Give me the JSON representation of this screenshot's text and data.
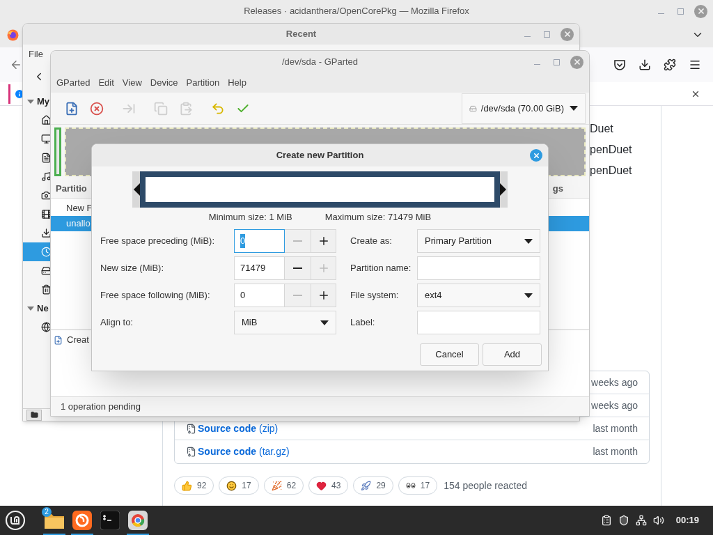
{
  "firefox": {
    "title": "Releases · acidanthera/OpenCorePkg — Mozilla Firefox",
    "page_lines": [
      "Duet",
      "penDuet",
      "penDuet"
    ],
    "assets": [
      {
        "time": "weeks ago"
      },
      {
        "time": "weeks ago"
      },
      {
        "name": "Source code",
        "ext": "(zip)",
        "time": "last month"
      },
      {
        "name": "Source code",
        "ext": "(tar.gz)",
        "time": "last month"
      }
    ],
    "reactions": [
      {
        "kind": "thumbs_up",
        "count": "92"
      },
      {
        "kind": "laugh",
        "count": "17"
      },
      {
        "kind": "hooray",
        "count": "62"
      },
      {
        "kind": "heart",
        "count": "43"
      },
      {
        "kind": "rocket",
        "count": "29"
      },
      {
        "kind": "eyes",
        "count": "17"
      }
    ],
    "reactions_summary": "154 people reacted"
  },
  "files_window": {
    "title": "Recent",
    "menu": [
      "File"
    ],
    "sidebar": [
      {
        "heading": "My",
        "items": [
          {
            "kind": "home",
            "selected": false
          },
          {
            "kind": "desktop",
            "selected": false
          },
          {
            "kind": "documents",
            "selected": false
          },
          {
            "kind": "music",
            "selected": false
          },
          {
            "kind": "pictures",
            "selected": false
          },
          {
            "kind": "videos",
            "selected": false
          },
          {
            "kind": "downloads",
            "selected": false
          },
          {
            "kind": "recent",
            "selected": true
          },
          {
            "kind": "computer",
            "selected": false
          },
          {
            "kind": "trash",
            "selected": false
          }
        ]
      },
      {
        "heading": "Ne",
        "items": [
          {
            "kind": "network",
            "selected": false
          }
        ]
      }
    ]
  },
  "gparted": {
    "title": "/dev/sda - GParted",
    "menu": [
      "GParted",
      "Edit",
      "View",
      "Device",
      "Partition",
      "Help"
    ],
    "toolbar": [
      {
        "kind": "new",
        "disabled": false
      },
      {
        "kind": "delete",
        "disabled": false
      },
      {
        "kind": "resize",
        "disabled": true
      },
      {
        "kind": "copy",
        "disabled": true
      },
      {
        "kind": "paste",
        "disabled": true
      },
      {
        "kind": "undo",
        "disabled": false
      },
      {
        "kind": "apply",
        "disabled": false
      }
    ],
    "device": "/dev/sda (70.00 GiB)",
    "columns": [
      "Partitio",
      "gs"
    ],
    "rows": [
      {
        "cell": "New F",
        "selected": false
      },
      {
        "cell": "unallo",
        "selected": true
      }
    ],
    "operations": [
      "Creat"
    ],
    "status": "1 operation pending"
  },
  "dialog": {
    "title": "Create new Partition",
    "min_size": "Minimum size: 1 MiB",
    "max_size": "Maximum size: 71479 MiB",
    "left_rows": [
      {
        "label": "Free space preceding (MiB):",
        "kind": "spin",
        "value": "0",
        "focused": true,
        "minus_disabled": true,
        "plus_disabled": false
      },
      {
        "label": "New size (MiB):",
        "kind": "spin",
        "value": "71479",
        "focused": false,
        "minus_disabled": false,
        "plus_disabled": true
      },
      {
        "label": "Free space following (MiB):",
        "kind": "spin",
        "value": "0",
        "focused": false,
        "minus_disabled": true,
        "plus_disabled": false
      },
      {
        "label": "Align to:",
        "kind": "dropdown",
        "value": "MiB"
      }
    ],
    "right_rows": [
      {
        "label": "Create as:",
        "kind": "dropdown",
        "value": "Primary Partition"
      },
      {
        "label": "Partition name:",
        "kind": "text"
      },
      {
        "label": "File system:",
        "kind": "dropdown",
        "value": "ext4"
      },
      {
        "label": "Label:",
        "kind": "text"
      }
    ],
    "buttons": [
      "Cancel",
      "Add"
    ]
  },
  "taskbar": {
    "launchers": [
      {
        "kind": "files",
        "badge": "2",
        "running": true
      },
      {
        "kind": "firefox",
        "running": true
      },
      {
        "kind": "terminal",
        "running": false
      },
      {
        "kind": "chrome",
        "running": true
      }
    ],
    "clock": "00:19"
  }
}
